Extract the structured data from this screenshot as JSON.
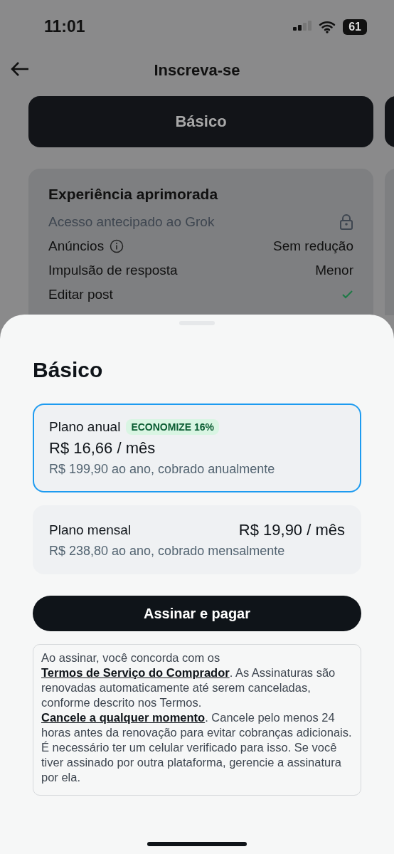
{
  "status_bar": {
    "time": "11:01",
    "battery": "61"
  },
  "header": {
    "title": "Inscreva-se"
  },
  "tiers": [
    {
      "label": "Básico"
    }
  ],
  "features": {
    "title": "Experiência aprimorada",
    "rows": [
      {
        "label": "Acesso antecipado ao Grok",
        "kind": "locked"
      },
      {
        "label": "Anúncios",
        "kind": "info",
        "value": "Sem redução"
      },
      {
        "label": "Impulsão de resposta",
        "kind": "text",
        "value": "Menor"
      },
      {
        "label": "Editar post",
        "kind": "check"
      }
    ]
  },
  "sheet": {
    "title": "Básico",
    "plans": [
      {
        "name": "Plano anual",
        "badge": "ECONOMIZE 16%",
        "price": "R$ 16,66 / mês",
        "note": "R$ 199,90 ao ano, cobrado anualmente",
        "selected": true
      },
      {
        "name": "Plano mensal",
        "price": "R$ 19,90 / mês",
        "note": "R$ 238,80 ao ano, cobrado mensalmente",
        "selected": false
      }
    ],
    "button": "Assinar e pagar",
    "terms": [
      {
        "kind": "text",
        "text": "Ao assinar, você concorda com os "
      },
      {
        "kind": "link",
        "text": "Termos de Serviço do Comprador"
      },
      {
        "kind": "text",
        "text": ". As Assinaturas são renovadas automaticamente até serem canceladas, conforme descrito nos Termos. "
      },
      {
        "kind": "link",
        "text": "Cancele a qualquer momento"
      },
      {
        "kind": "text",
        "text": ". Cancele pelo menos 24 horas antes da renovação para evitar cobranças adicionais. É necessário ter um celular verificado para isso. Se você tiver assinado por outra plataforma, gerencie a assinatura por ela."
      }
    ]
  }
}
